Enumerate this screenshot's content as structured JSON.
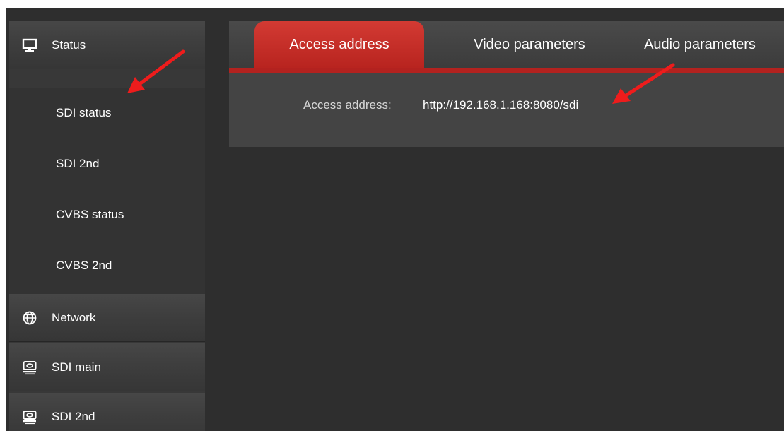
{
  "sidebar": {
    "status_group": {
      "label": "Status",
      "icon": "monitor-icon"
    },
    "sub_items": [
      {
        "label": "SDI status"
      },
      {
        "label": "SDI 2nd"
      },
      {
        "label": "CVBS status"
      },
      {
        "label": "CVBS 2nd"
      }
    ],
    "groups": [
      {
        "label": "Network",
        "icon": "globe-icon"
      },
      {
        "label": "SDI main",
        "icon": "video-device-icon"
      },
      {
        "label": "SDI 2nd",
        "icon": "video-device-icon"
      }
    ]
  },
  "tabs": [
    {
      "label": "Access address",
      "active": true
    },
    {
      "label": "Video parameters",
      "active": false
    },
    {
      "label": "Audio parameters",
      "active": false
    }
  ],
  "content": {
    "access_address_label": "Access address:",
    "access_address_value": "http://192.168.1.168:8080/sdi"
  },
  "colors": {
    "accent_red": "#b8241f",
    "annotation_arrow": "#ee1c1c",
    "background": "#2e2e2e"
  }
}
